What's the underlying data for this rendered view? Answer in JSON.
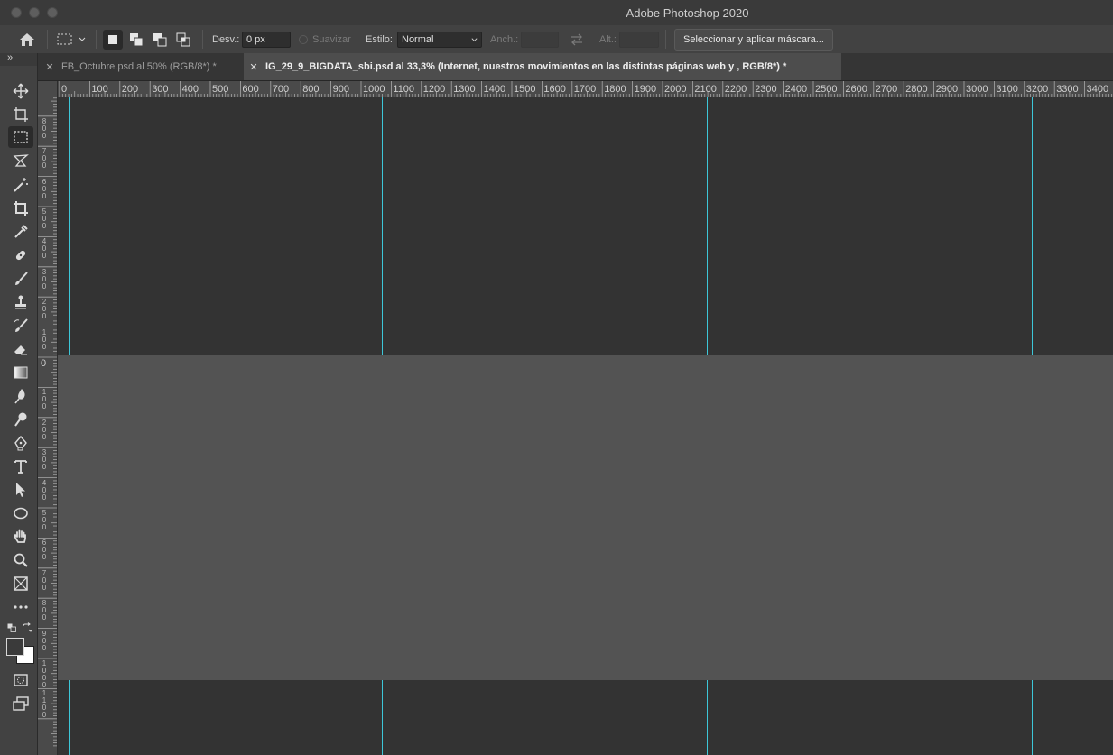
{
  "window": {
    "title": "Adobe Photoshop 2020"
  },
  "options_bar": {
    "feather_label": "Desv.:",
    "feather_value": "0 px",
    "antialias_label": "Suavizar",
    "style_label": "Estilo:",
    "style_value": "Normal",
    "width_label": "Anch.:",
    "height_label": "Alt.:",
    "mask_button": "Seleccionar y aplicar máscara..."
  },
  "tabs": [
    {
      "label": "FB_Octubre.psd al 50% (RGB/8*) *",
      "active": false
    },
    {
      "label": "IG_29_9_BIGDATA_sbi.psd al 33,3% (Internet, nuestros movimientos en las distintas  páginas web y , RGB/8*) *",
      "active": true
    }
  ],
  "tools_panel": {
    "collapse_glyph": "»",
    "tools": [
      "move-icon",
      "artboard-icon",
      "rectangular-marquee-icon",
      "lasso-icon",
      "magic-wand-icon",
      "crop-icon",
      "eyedropper-icon",
      "healing-brush-icon",
      "brush-icon",
      "clone-stamp-icon",
      "history-brush-icon",
      "eraser-icon",
      "gradient-icon",
      "blur-icon",
      "dodge-icon",
      "pen-icon",
      "type-icon",
      "path-selection-icon",
      "ellipse-icon",
      "hand-icon",
      "zoom-icon",
      "frame-icon",
      "more-tools-icon"
    ],
    "active_tool": "rectangular-marquee-icon",
    "foreground_color": "#3a3a3a",
    "background_color": "#ffffff"
  },
  "rulers": {
    "horizontal_labels": [
      "0",
      "100",
      "200",
      "300",
      "400",
      "500",
      "600",
      "700",
      "800",
      "900",
      "1000",
      "1100",
      "1200",
      "1300",
      "1400",
      "1500",
      "1600",
      "1700",
      "1800",
      "1900",
      "2000",
      "2100",
      "2200",
      "2300",
      "2400",
      "2500",
      "2600",
      "2700",
      "2800",
      "2900",
      "3000",
      "3100",
      "3200",
      "3300",
      "3400"
    ],
    "vertical_labels_upper": [
      "800",
      "700",
      "600",
      "500",
      "400",
      "300",
      "200",
      "100"
    ],
    "vertical_zero": "0",
    "vertical_labels_lower": [
      "100",
      "200",
      "300",
      "400",
      "500",
      "600",
      "700",
      "800",
      "900",
      "1000",
      "1100"
    ]
  },
  "colors": {
    "guide": "#3dc7d8",
    "document_bg": "#333333",
    "pasteboard": "#535353"
  }
}
